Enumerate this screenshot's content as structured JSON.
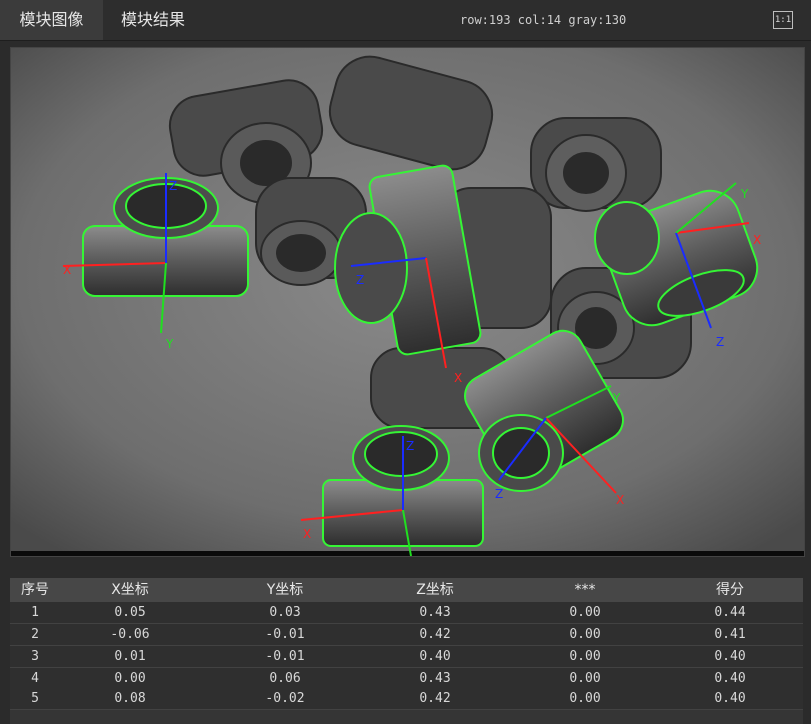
{
  "tabs": [
    {
      "label": "模块图像"
    },
    {
      "label": "模块结果"
    }
  ],
  "status": {
    "text": "row:193 col:14 gray:130"
  },
  "fit_button": {
    "label": "1:1"
  },
  "axes_labels": {
    "x": "X",
    "y": "Y",
    "z": "Z"
  },
  "colors": {
    "x_axis": "#ff2020",
    "y_axis": "#20e020",
    "z_axis": "#1a2cff",
    "contour": "#35f535"
  },
  "table": {
    "headers": [
      "序号",
      "X坐标",
      "Y坐标",
      "Z坐标",
      "***",
      "得分"
    ],
    "rows": [
      [
        "1",
        "0.05",
        "0.03",
        "0.43",
        "0.00",
        "0.44"
      ],
      [
        "2",
        "-0.06",
        "-0.01",
        "0.42",
        "0.00",
        "0.41"
      ],
      [
        "3",
        "0.01",
        "-0.01",
        "0.40",
        "0.00",
        "0.40"
      ],
      [
        "4",
        "0.00",
        "0.06",
        "0.43",
        "0.00",
        "0.40"
      ],
      [
        "5",
        "0.08",
        "-0.02",
        "0.42",
        "0.00",
        "0.40"
      ]
    ]
  }
}
